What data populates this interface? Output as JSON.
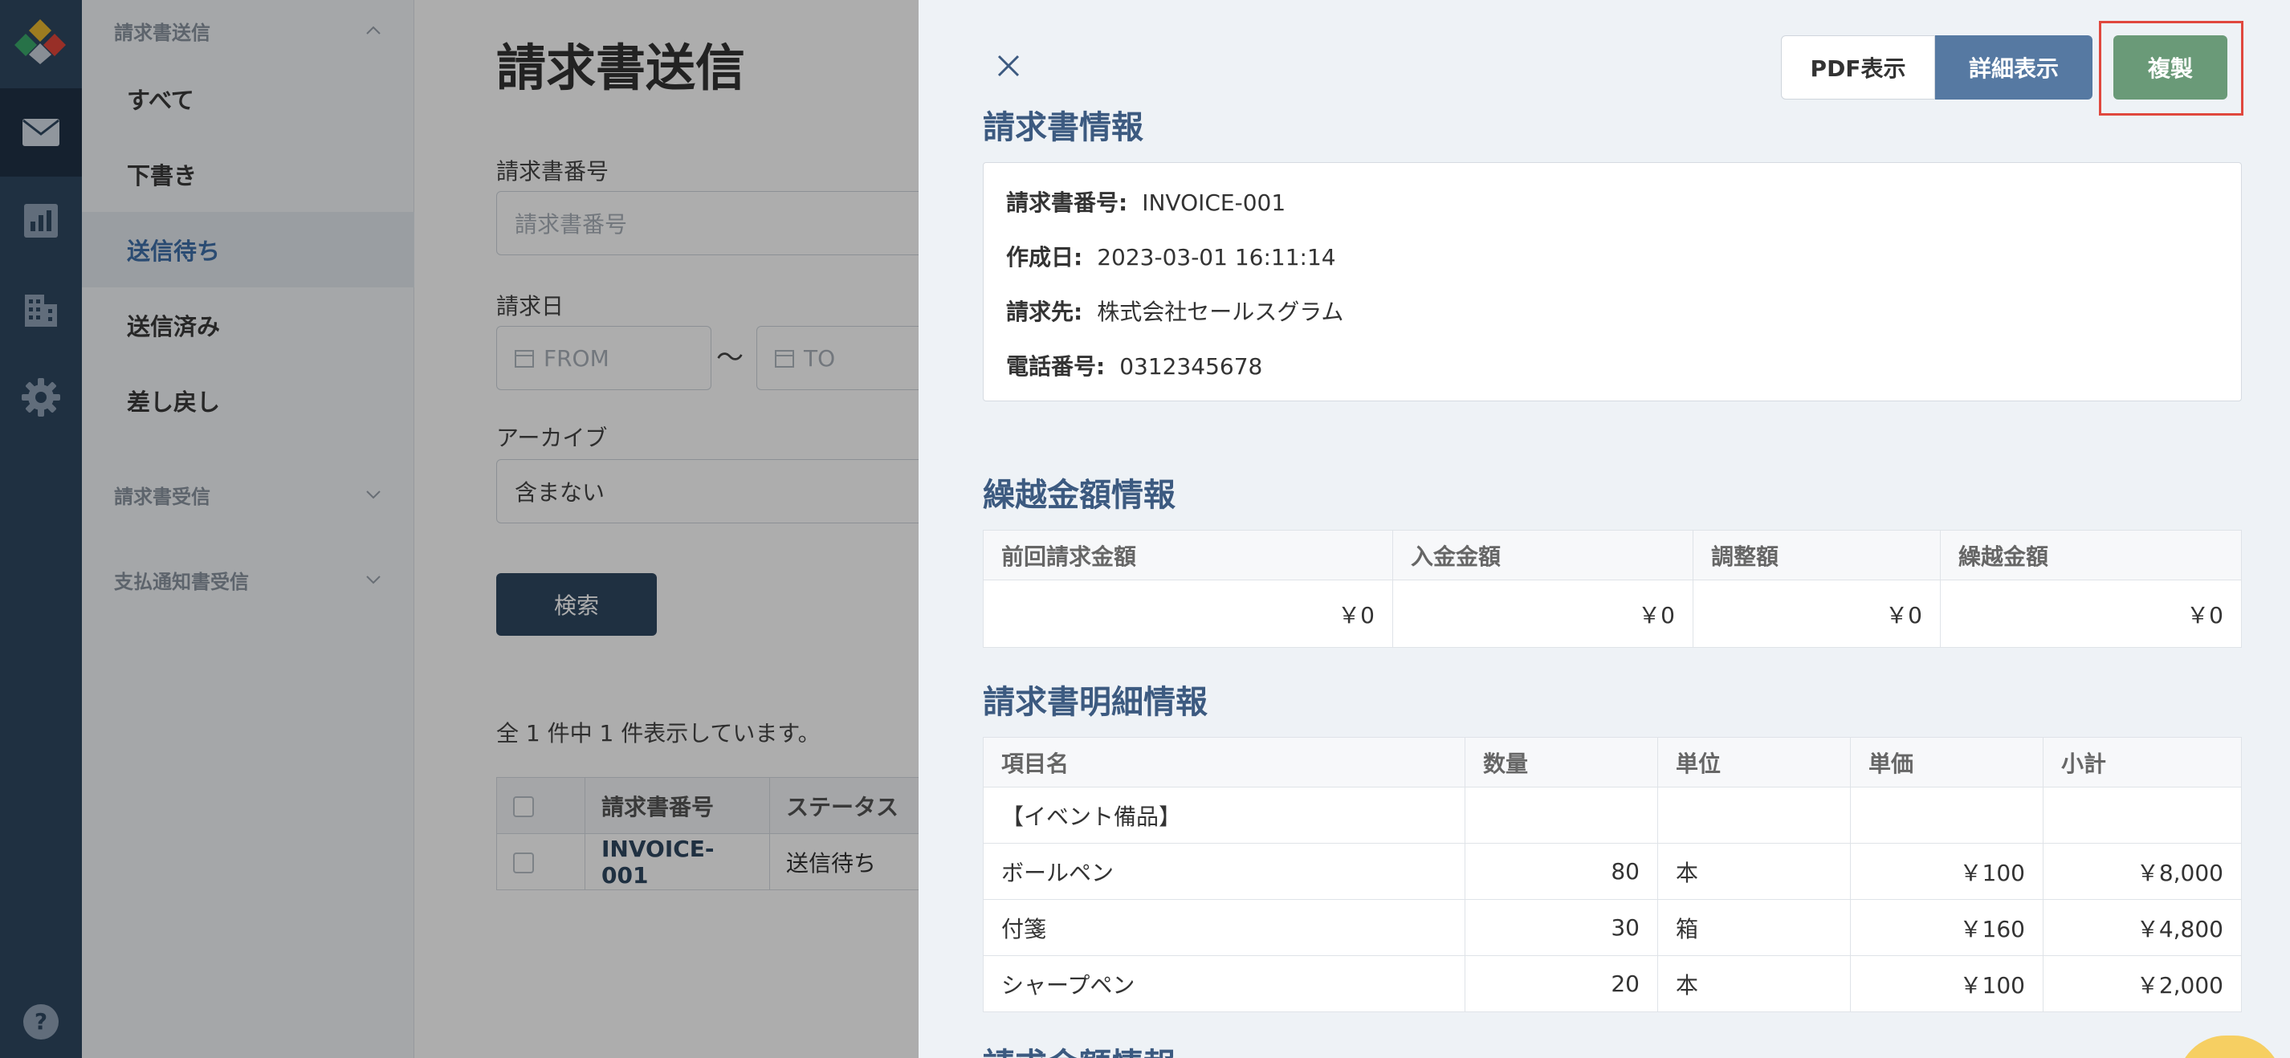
{
  "sidebar": {
    "groups": [
      {
        "label": "請求書送信"
      },
      {
        "label": "請求書受信"
      },
      {
        "label": "支払通知書受信"
      }
    ],
    "items": [
      {
        "label": "すべて"
      },
      {
        "label": "下書き"
      },
      {
        "label": "送信待ち"
      },
      {
        "label": "送信済み"
      },
      {
        "label": "差し戻し"
      }
    ]
  },
  "main": {
    "title": "請求書送信",
    "invoice_no_label": "請求書番号",
    "invoice_no_placeholder": "請求書番号",
    "date_label": "請求日",
    "date_from_placeholder": "FROM",
    "date_to_placeholder": "TO",
    "tilde": "〜",
    "archive_label": "アーカイブ",
    "archive_value": "含まない",
    "search_button": "検索",
    "result_text": "全 1 件中 1 件表示しています。",
    "table": {
      "headers": [
        "請求書番号",
        "ステータス"
      ],
      "rows": [
        {
          "invoice_no": "INVOICE-001",
          "status": "送信待ち"
        }
      ]
    }
  },
  "panel": {
    "buttons": {
      "pdf": "PDF表示",
      "detail": "詳細表示",
      "copy": "複製"
    },
    "invoice_info": {
      "title": "請求書情報",
      "rows": [
        {
          "key": "請求書番号:",
          "value": "INVOICE-001"
        },
        {
          "key": "作成日:",
          "value": "2023-03-01 16:11:14"
        },
        {
          "key": "請求先:",
          "value": "株式会社セールスグラム"
        },
        {
          "key": "電話番号:",
          "value": "0312345678"
        }
      ]
    },
    "carryover": {
      "title": "繰越金額情報",
      "headers": [
        "前回請求金額",
        "入金金額",
        "調整額",
        "繰越金額"
      ],
      "values": [
        "￥0",
        "￥0",
        "￥0",
        "￥0"
      ]
    },
    "details": {
      "title": "請求書明細情報",
      "headers": [
        "項目名",
        "数量",
        "単位",
        "単価",
        "小計"
      ],
      "rows": [
        {
          "name": "【イベント備品】",
          "qty": "",
          "unit": "",
          "price": "",
          "subtotal": ""
        },
        {
          "name": "ボールペン",
          "qty": "80",
          "unit": "本",
          "price": "￥100",
          "subtotal": "￥8,000"
        },
        {
          "name": "付箋",
          "qty": "30",
          "unit": "箱",
          "price": "￥160",
          "subtotal": "￥4,800"
        },
        {
          "name": "シャープペン",
          "qty": "20",
          "unit": "本",
          "price": "￥100",
          "subtotal": "￥2,000"
        }
      ]
    },
    "next_section_title": "請求金額情報"
  },
  "colors": {
    "rail": "#2f4761",
    "accent_blue": "#5679a2",
    "copy_green": "#6a9a78",
    "highlight_red": "#e0483e",
    "section_title": "#3c5a80"
  },
  "icons": [
    "logo-icon",
    "mail-icon",
    "chart-icon",
    "building-icon",
    "gear-icon",
    "help-icon",
    "chevron-up-icon",
    "chevron-down-icon",
    "calendar-icon",
    "close-icon"
  ]
}
